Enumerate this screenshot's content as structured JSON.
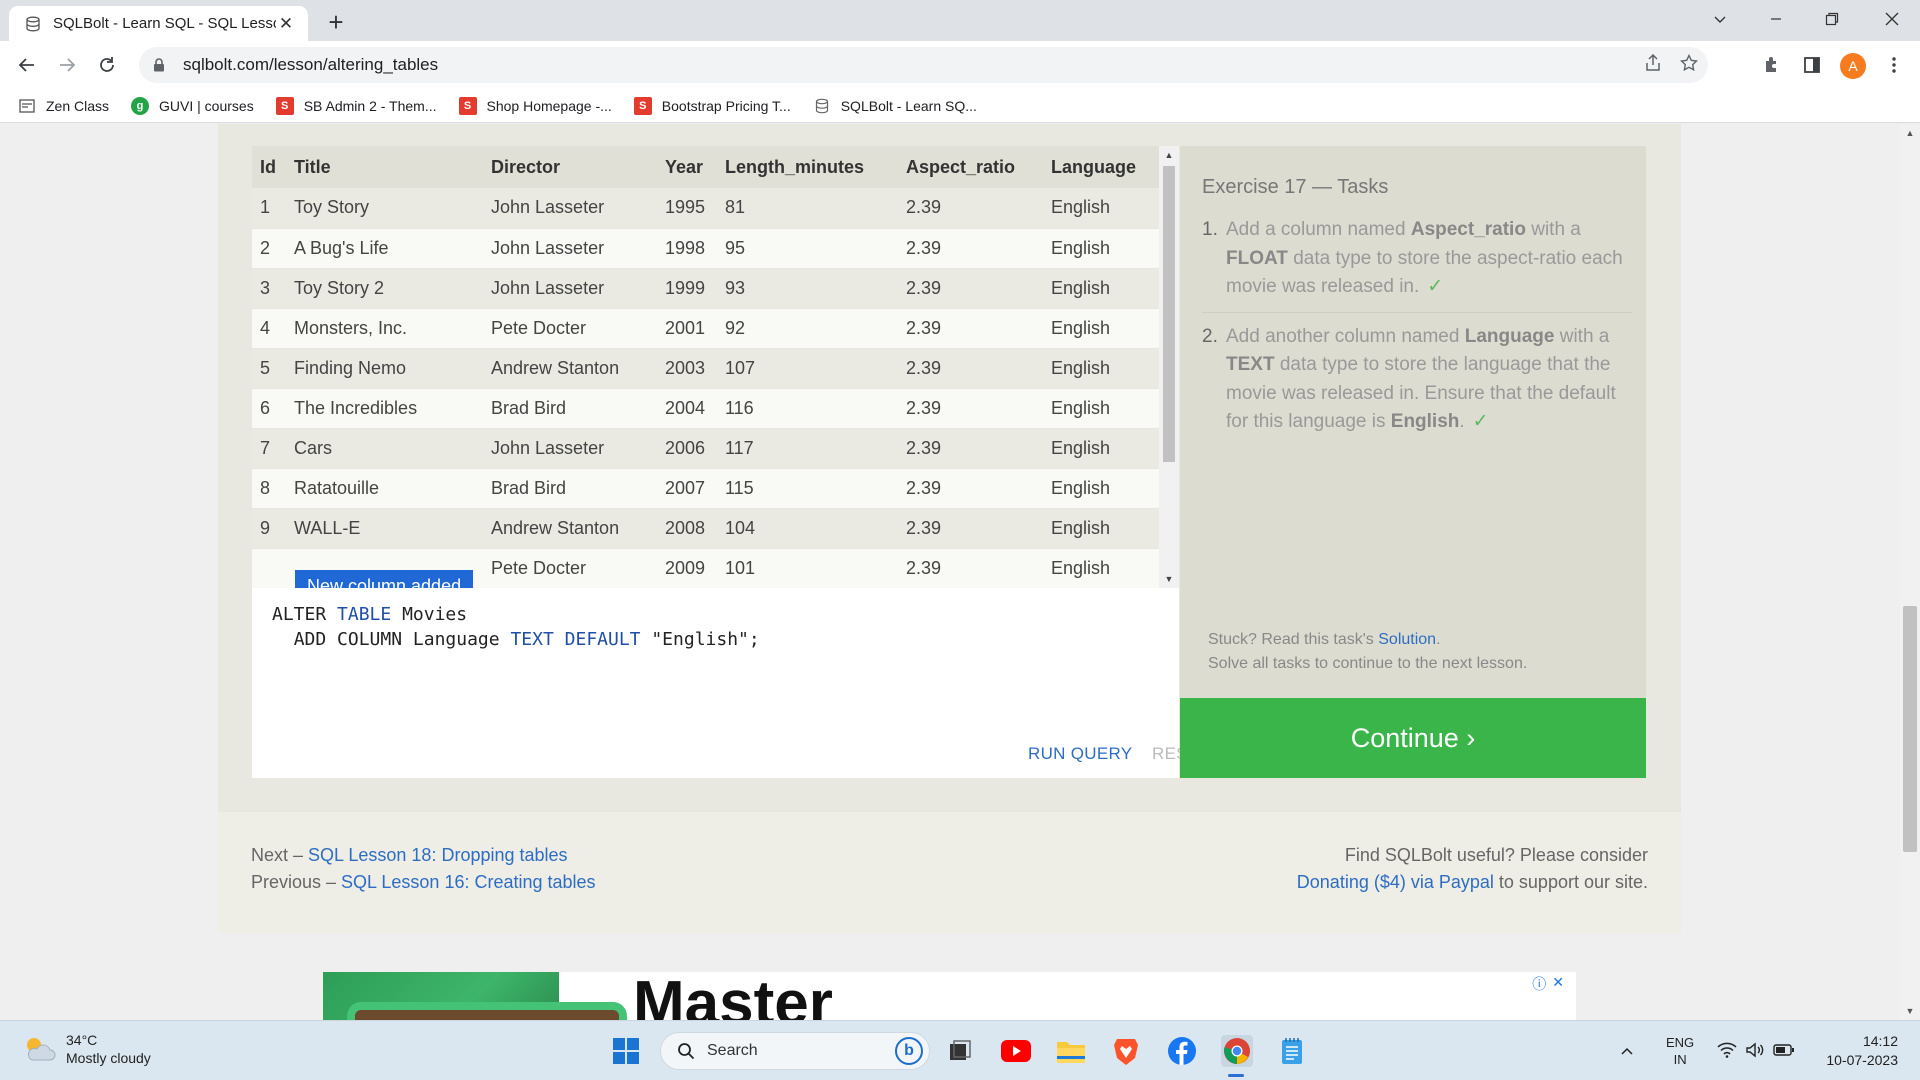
{
  "browser": {
    "tab_title": "SQLBolt - Learn SQL - SQL Lesso",
    "url": "sqlbolt.com/lesson/altering_tables",
    "profile_initial": "A",
    "bookmarks": [
      {
        "label": "Zen Class",
        "icon": "page-icon",
        "color": "#555555"
      },
      {
        "label": "GUVI | courses",
        "icon": "guvi-icon",
        "color": "#22a447"
      },
      {
        "label": "SB Admin 2 - Them...",
        "icon": "s-icon",
        "color": "#e33b2e"
      },
      {
        "label": "Shop Homepage -...",
        "icon": "s-icon",
        "color": "#e33b2e"
      },
      {
        "label": "Bootstrap Pricing T...",
        "icon": "s-icon",
        "color": "#e33b2e"
      },
      {
        "label": "SQLBolt - Learn SQ...",
        "icon": "database-icon",
        "color": "#777777"
      }
    ]
  },
  "table": {
    "headers": [
      "Id",
      "Title",
      "Director",
      "Year",
      "Length_minutes",
      "Aspect_ratio",
      "Language"
    ],
    "rows": [
      [
        "1",
        "Toy Story",
        "John Lasseter",
        "1995",
        "81",
        "2.39",
        "English"
      ],
      [
        "2",
        "A Bug's Life",
        "John Lasseter",
        "1998",
        "95",
        "2.39",
        "English"
      ],
      [
        "3",
        "Toy Story 2",
        "John Lasseter",
        "1999",
        "93",
        "2.39",
        "English"
      ],
      [
        "4",
        "Monsters, Inc.",
        "Pete Docter",
        "2001",
        "92",
        "2.39",
        "English"
      ],
      [
        "5",
        "Finding Nemo",
        "Andrew Stanton",
        "2003",
        "107",
        "2.39",
        "English"
      ],
      [
        "6",
        "The Incredibles",
        "Brad Bird",
        "2004",
        "116",
        "2.39",
        "English"
      ],
      [
        "7",
        "Cars",
        "John Lasseter",
        "2006",
        "117",
        "2.39",
        "English"
      ],
      [
        "8",
        "Ratatouille",
        "Brad Bird",
        "2007",
        "115",
        "2.39",
        "English"
      ],
      [
        "9",
        "WALL-E",
        "Andrew Stanton",
        "2008",
        "104",
        "2.39",
        "English"
      ],
      [
        "",
        "",
        "Pete Docter",
        "2009",
        "101",
        "2.39",
        "English"
      ]
    ],
    "toast": "New column added"
  },
  "editor": {
    "line1": {
      "kw1": "ALTER",
      "kw2": "TABLE",
      "rest": "Movies"
    },
    "line2": {
      "kw1": "ADD COLUMN Language",
      "type": "TEXT",
      "kw3": "DEFAULT",
      "str": "\"English\";"
    },
    "run_label": "RUN QUERY",
    "reset_label": "RESET"
  },
  "tasks": {
    "title": "Exercise 17 — Tasks",
    "items": [
      {
        "num": "1.",
        "pre": "Add a column named ",
        "b1": "Aspect_ratio",
        "mid": " with a ",
        "b2": "FLOAT",
        "post": " data type to store the aspect-ratio each movie was released in.",
        "check": "✓"
      },
      {
        "num": "2.",
        "pre": "Add another column named ",
        "b1": "Language",
        "mid": " with a ",
        "b2": "TEXT",
        "post": " data type to store the language that the movie was released in. Ensure that the default for this language is ",
        "b3": "English",
        "tail": ".",
        "check": "✓"
      }
    ],
    "stuck_pre": "Stuck? Read this task's ",
    "stuck_link": "Solution",
    "stuck_post": ".",
    "solve_all": "Solve all tasks to continue to the next lesson.",
    "continue_label": "Continue ›"
  },
  "footer": {
    "next_prefix": "Next – ",
    "next_link": "SQL Lesson 18: Dropping tables",
    "prev_prefix": "Previous – ",
    "prev_link": "SQL Lesson 16: Creating tables",
    "useful": "Find SQLBolt useful? Please consider",
    "donate_link": "Donating ($4) via Paypal",
    "donate_post": " to support our site."
  },
  "ad": {
    "headline": "Master"
  },
  "taskbar": {
    "temp": "34°C",
    "weather": "Mostly cloudy",
    "search_label": "Search",
    "lang1": "ENG",
    "lang2": "IN",
    "time": "14:12",
    "date": "10-07-2023"
  }
}
